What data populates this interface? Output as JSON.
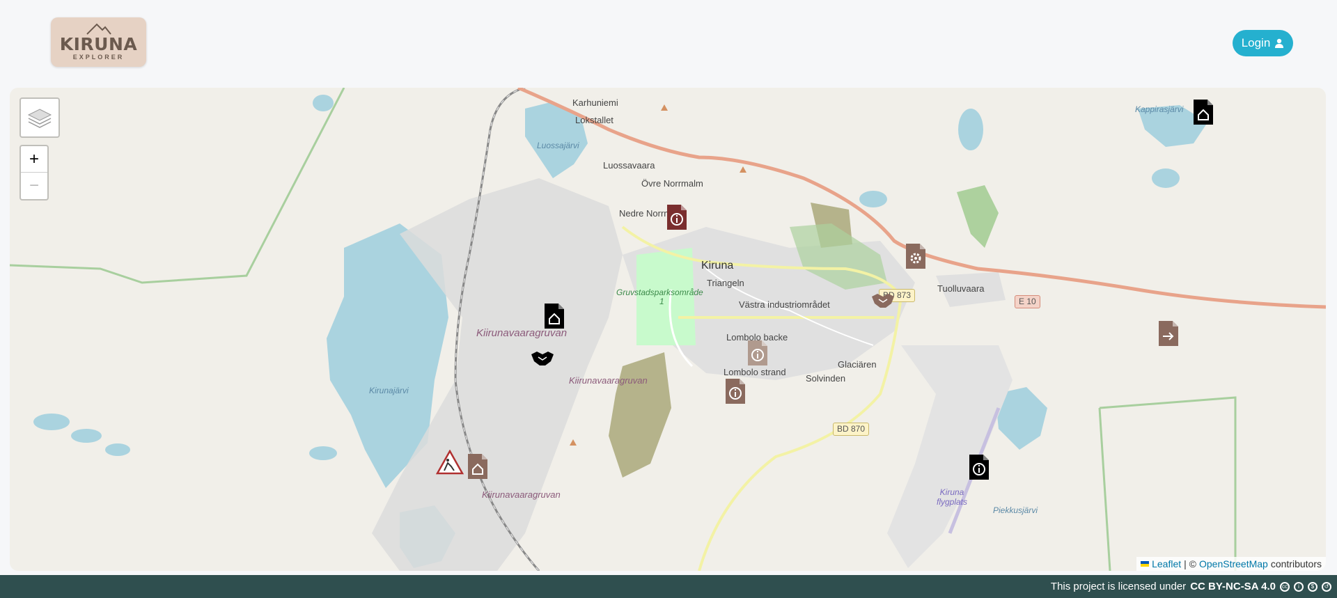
{
  "header": {
    "logo_title": "KIRUNA",
    "logo_subtitle": "EXPLORER",
    "login_label": "Login"
  },
  "map": {
    "zoom_in_label": "+",
    "zoom_out_label": "−",
    "labels": {
      "karhuniemi": "Karhuniemi",
      "lokstallet": "Lokstallet",
      "luossajarvi": "Luossajärvi",
      "luossavaara": "Luossavaara",
      "ovre_norrmalm": "Övre Norrmalm",
      "nedre_norrmalm": "Nedre Norrmalm",
      "kiruna": "Kiruna",
      "triangeln": "Triangeln",
      "gruvstad": "Gruvstadsparksområde",
      "gruvstad_num": "1",
      "vastra": "Västra industriområdet",
      "kiirunavaara_big": "Kiirunavaaragruvan",
      "kiirunavaara_2": "Kiirunavaaragruvan",
      "kiirunavaara_3": "Kiirunavaaragruvan",
      "kirunajarvi": "Kirunajärvi",
      "lombolo_backe": "Lombolo backe",
      "lombolo_strand": "Lombolo strand",
      "glaciaren": "Glaciären",
      "solvinden": "Solvinden",
      "tuolluvaara": "Tuolluvaara",
      "kappirasjarvi": "Kappirasjärvi",
      "airport": "Kiruna flygplats",
      "piekkusjarvi": "Piekkusjärvi"
    },
    "roads": {
      "e10": "E 10",
      "bd873": "BD 873",
      "bd870": "BD 870"
    },
    "attribution": {
      "leaflet": "Leaflet",
      "separator": "| ©",
      "osm": "OpenStreetMap",
      "contributors": "contributors"
    },
    "markers": [
      {
        "name": "informative-document-marker",
        "icon": "info",
        "color": "#7a2e2e"
      },
      {
        "name": "architectural-plan-marker",
        "icon": "house",
        "color": "#000000"
      },
      {
        "name": "technical-document-marker",
        "icon": "gear",
        "color": "#8a6a5e"
      },
      {
        "name": "agreement-marker",
        "icon": "handshake",
        "color": "#000000"
      },
      {
        "name": "prescriptive-document-marker",
        "icon": "arrow",
        "color": "#8a6a5e"
      },
      {
        "name": "informative-document-marker",
        "icon": "info",
        "color": "#8a6a5e"
      },
      {
        "name": "construction-marker",
        "icon": "warning",
        "color": "#b03030"
      },
      {
        "name": "architectural-plan-marker",
        "icon": "house",
        "color": "#8a6a5e"
      }
    ]
  },
  "footer": {
    "license_prefix": "This project is licensed under",
    "license_name": "CC BY-NC-SA 4.0"
  }
}
